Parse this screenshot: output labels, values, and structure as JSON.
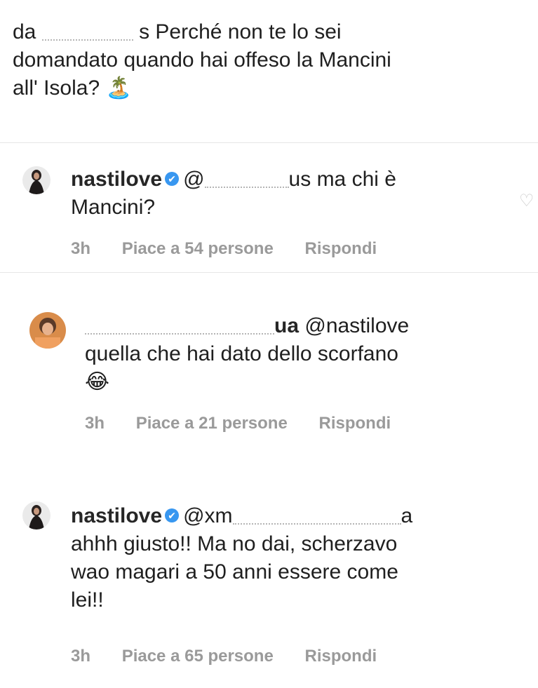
{
  "top_comment": {
    "prefix": "da",
    "suffix": "s Perché non te lo sei",
    "line2": "domandato quando hai offeso la Mancini",
    "line3": "all' Isola?",
    "emoji": "🏝️"
  },
  "replies": [
    {
      "username": "nastilove",
      "verified": true,
      "mention_tail": "us",
      "text1": "ma chi è",
      "text2": "Mancini?",
      "time": "3h",
      "likes": "Piace a 54 persone",
      "reply": "Rispondi"
    },
    {
      "username_tail": "ua",
      "mention": "@nastilove",
      "text1": "quella che hai dato dello scorfano",
      "emoji": "😂",
      "time": "3h",
      "likes": "Piace a 21 persone",
      "reply": "Rispondi"
    },
    {
      "username": "nastilove",
      "verified": true,
      "mention": "@xm",
      "mention_tail": "a",
      "text1": "ahhh giusto!! Ma no dai, scherzavo",
      "text2": "wao magari a 50 anni essere come",
      "text3": "lei!!",
      "time": "3h",
      "likes": "Piace a 65 persone",
      "reply": "Rispondi"
    }
  ],
  "icons": {
    "heart": "heart-icon",
    "verified": "verified-badge-icon"
  }
}
